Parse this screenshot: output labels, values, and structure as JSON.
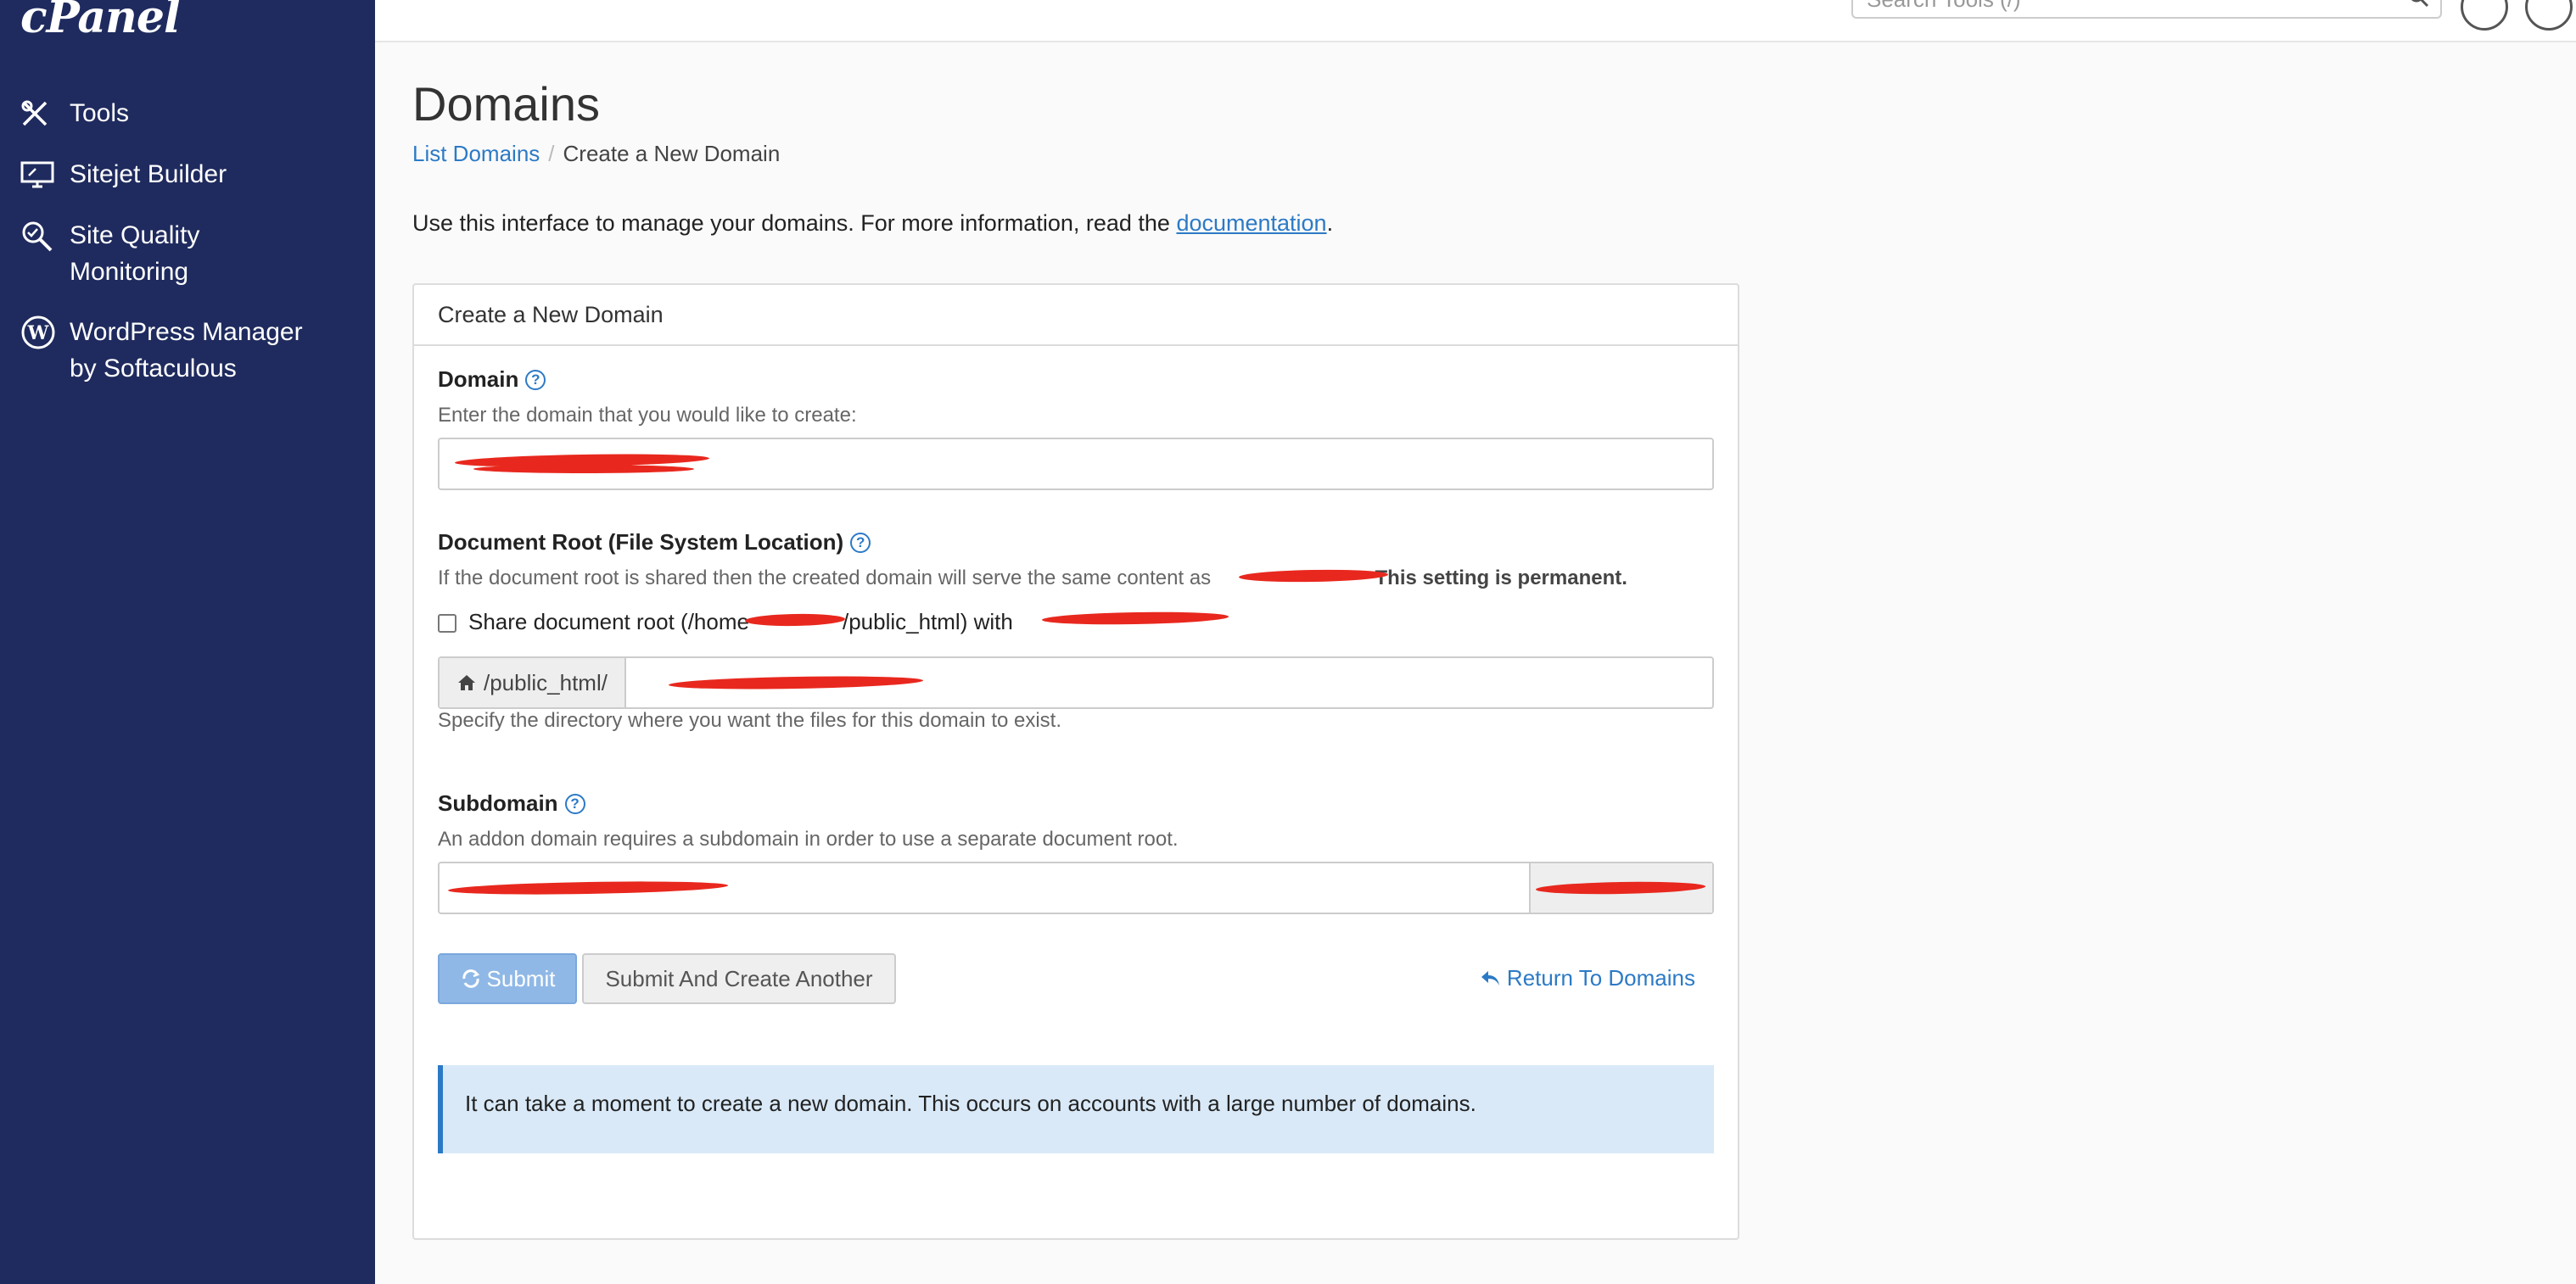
{
  "sidebar": {
    "logo": "cPanel",
    "items": [
      {
        "label": "Tools",
        "icon": "tools-icon"
      },
      {
        "label": "Sitejet Builder",
        "icon": "monitor-icon"
      },
      {
        "label": "Site Quality",
        "label2": "Monitoring",
        "icon": "magnify-check-icon"
      },
      {
        "label": "WordPress Manager",
        "label2": "by Softaculous",
        "icon": "wordpress-icon"
      }
    ]
  },
  "header": {
    "search_placeholder": "Search Tools (/)"
  },
  "page": {
    "title": "Domains",
    "breadcrumb_link": "List Domains",
    "breadcrumb_sep": "/",
    "breadcrumb_current": "Create a New Domain",
    "intro_text": "Use this interface to manage your domains. For more information, read the ",
    "intro_link": "documentation",
    "intro_end": "."
  },
  "form": {
    "panel_title": "Create a New Domain",
    "domain_label": "Domain",
    "domain_hint": "Enter the domain that you would like to create:",
    "docroot_label": "Document Root (File System Location)",
    "docroot_hint": "If the document root is shared then the created domain will serve the same content as",
    "docroot_permanent": "This setting is permanent.",
    "share_label_a": "Share document root (/home",
    "share_label_b": "/public_html) with",
    "docroot_prefix": "/public_html/",
    "docroot_help": "Specify the directory where you want the files for this domain to exist.",
    "subdomain_label": "Subdomain",
    "subdomain_hint": "An addon domain requires a subdomain in order to use a separate document root.",
    "submit_label": "Submit",
    "submit_another_label": "Submit And Create Another",
    "return_label": "Return To Domains",
    "alert_text": "It can take a moment to create a new domain. This occurs on accounts with a large number of domains."
  }
}
